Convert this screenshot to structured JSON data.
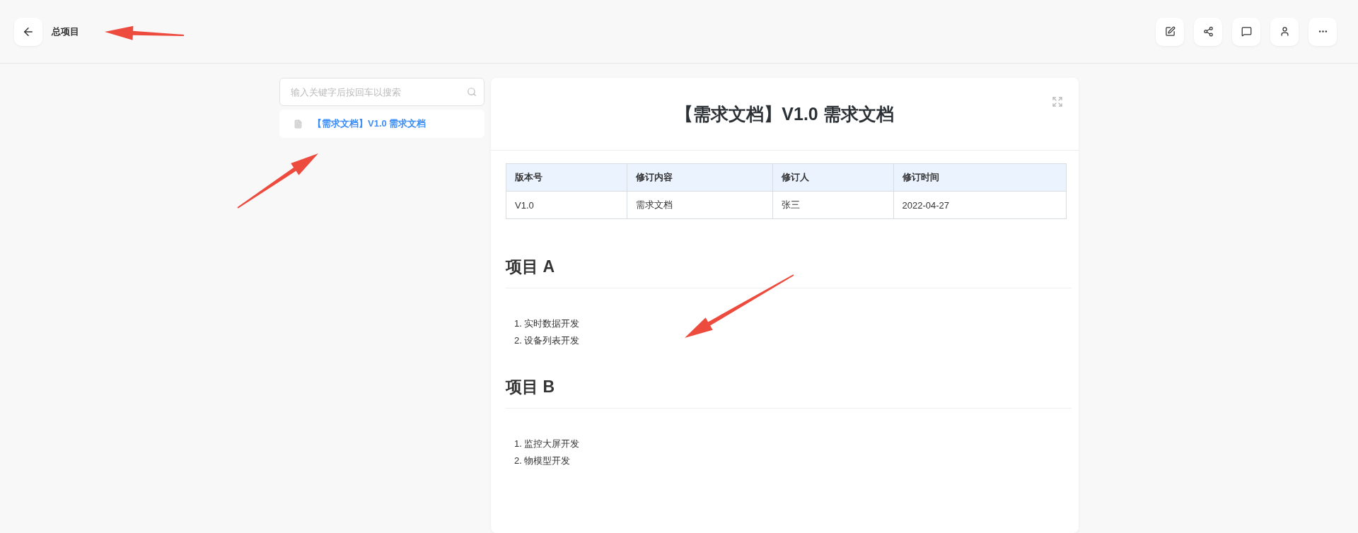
{
  "header": {
    "title": "总项目"
  },
  "sidebar": {
    "search": {
      "placeholder": "输入关键字后按回车以搜索"
    },
    "items": [
      {
        "label": "【需求文档】V1.0 需求文档",
        "selected": true
      }
    ]
  },
  "document": {
    "title": "【需求文档】V1.0 需求文档",
    "table": {
      "columns": [
        "版本号",
        "修订内容",
        "修订人",
        "修订时间"
      ],
      "rows": [
        [
          "V1.0",
          "需求文档",
          "张三",
          "2022-04-27"
        ]
      ]
    },
    "sections": [
      {
        "heading": "项目 A",
        "items": [
          {
            "number": "1.",
            "text": "实时数据开发"
          },
          {
            "number": "2.",
            "text": "设备列表开发"
          }
        ]
      },
      {
        "heading": "项目 B",
        "items": [
          {
            "number": "1.",
            "text": "监控大屏开发"
          },
          {
            "number": "2.",
            "text": "物模型开发"
          }
        ]
      }
    ]
  }
}
